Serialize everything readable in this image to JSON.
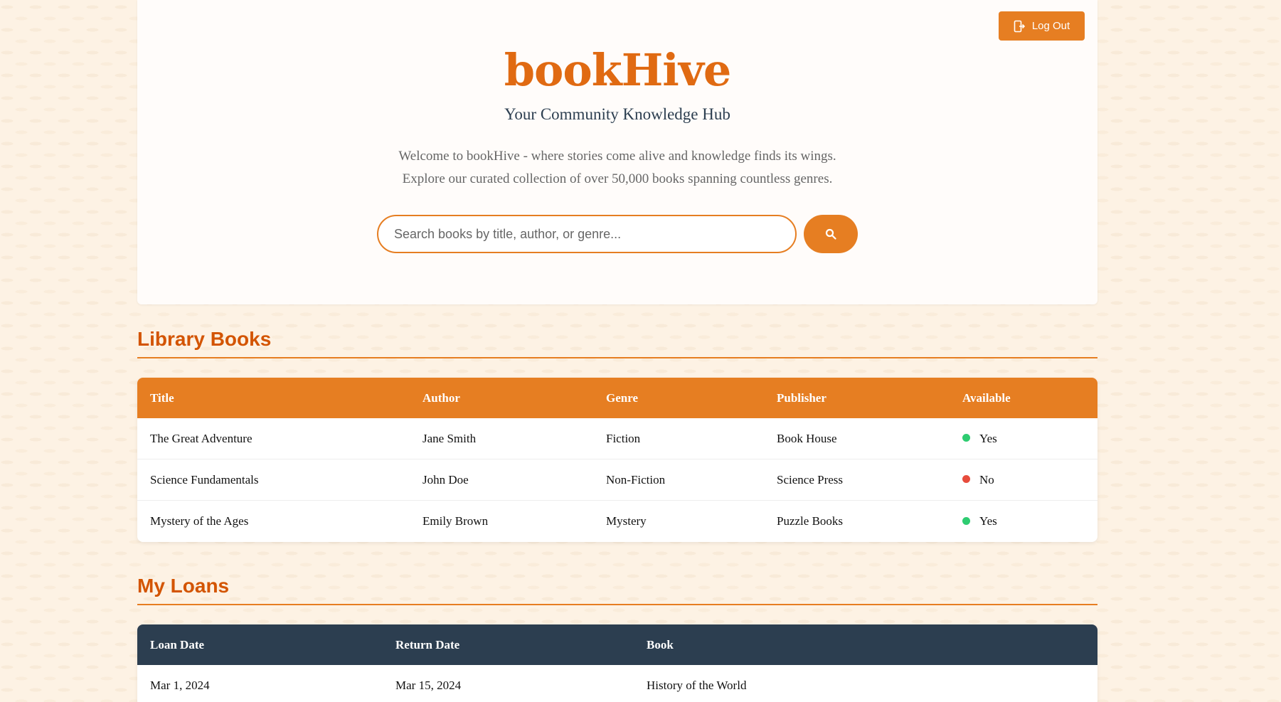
{
  "header": {
    "logout_label": "Log Out",
    "brand": "bookHive",
    "tagline": "Your Community Knowledge Hub",
    "intro_line1": "Welcome to bookHive - where stories come alive and knowledge finds its wings.",
    "intro_line2": "Explore our curated collection of over 50,000 books spanning countless genres."
  },
  "search": {
    "placeholder": "Search books by title, author, or genre...",
    "value": "",
    "button_icon": "search-icon"
  },
  "library": {
    "title": "Library Books",
    "columns": [
      "Title",
      "Author",
      "Genre",
      "Publisher",
      "Available"
    ],
    "rows": [
      {
        "title": "The Great Adventure",
        "author": "Jane Smith",
        "genre": "Fiction",
        "publisher": "Book House",
        "available": "Yes",
        "status_color": "#2ecc71"
      },
      {
        "title": "Science Fundamentals",
        "author": "John Doe",
        "genre": "Non-Fiction",
        "publisher": "Science Press",
        "available": "No",
        "status_color": "#e74c3c"
      },
      {
        "title": "Mystery of the Ages",
        "author": "Emily Brown",
        "genre": "Mystery",
        "publisher": "Puzzle Books",
        "available": "Yes",
        "status_color": "#2ecc71"
      }
    ]
  },
  "loans": {
    "title": "My Loans",
    "columns": [
      "Loan Date",
      "Return Date",
      "Book"
    ],
    "rows": [
      {
        "loan_date": "Mar 1, 2024",
        "return_date": "Mar 15, 2024",
        "book": "History of the World"
      }
    ]
  },
  "colors": {
    "accent": "#e67e22",
    "brand": "#e06a12",
    "heading": "#d35400",
    "dark_header": "#2c3e50",
    "available": "#2ecc71",
    "unavailable": "#e74c3c"
  }
}
